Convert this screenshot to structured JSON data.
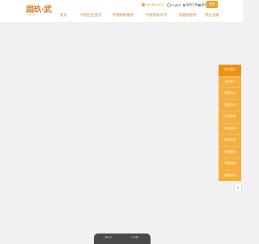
{
  "brand": {
    "logo_text": "固玖·武",
    "logo_sub": "GUJIU WU"
  },
  "header": {
    "phone": "400-880-0373",
    "lang": "English",
    "user": "我的订单",
    "biz": "服务",
    "login": "登录"
  },
  "nav": [
    "首页",
    "代理企业登记",
    "代理财税服务",
    "代理资质许可",
    "投融资服务",
    "积分兑换"
  ],
  "sidebar": {
    "items": [
      "关于我们",
      "企业简介",
      "新闻中心",
      "国税文件",
      "业务邮箱",
      "税务咨询",
      "服务优惠",
      "项目播报",
      "开发指南",
      "客服热线"
    ],
    "top": "▲"
  },
  "pager": {
    "prev": "⟵",
    "next": "⟶"
  },
  "colors": {
    "accent": "#f0a030",
    "sidebar_active": "#ec9116",
    "nav_text": "#c8873a"
  }
}
